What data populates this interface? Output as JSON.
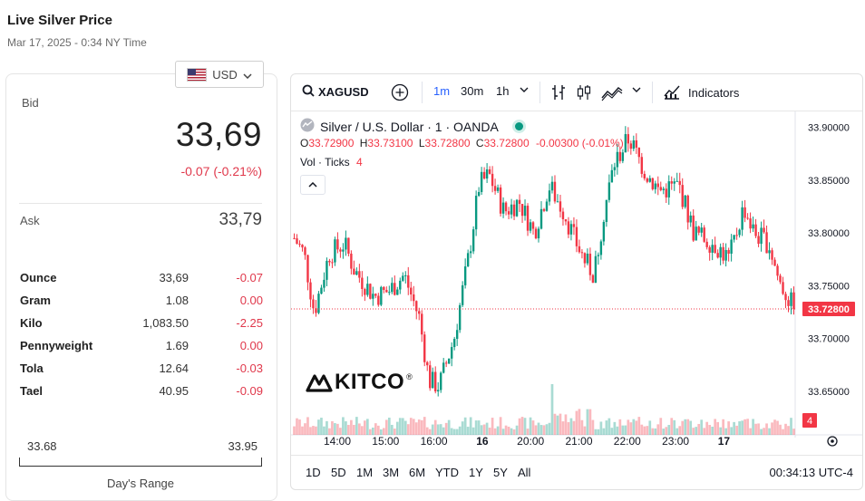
{
  "header": {
    "title": "Live Silver Price",
    "subtitle": "Mar 17, 2025 - 0:34 NY Time"
  },
  "currency": {
    "label": "USD",
    "icon": "us-flag-icon"
  },
  "bid": {
    "label": "Bid",
    "price": "33,69",
    "change": "-0.07 (-0.21%)"
  },
  "ask": {
    "label": "Ask",
    "price": "33,79"
  },
  "units": [
    {
      "name": "Ounce",
      "value": "33,69",
      "change": "-0.07"
    },
    {
      "name": "Gram",
      "value": "1.08",
      "change": "0.00"
    },
    {
      "name": "Kilo",
      "value": "1,083.50",
      "change": "-2.25"
    },
    {
      "name": "Pennyweight",
      "value": "1.69",
      "change": "0.00"
    },
    {
      "name": "Tola",
      "value": "12.64",
      "change": "-0.03"
    },
    {
      "name": "Tael",
      "value": "40.95",
      "change": "-0.09"
    }
  ],
  "range": {
    "low": "33.68",
    "high": "33.95",
    "label": "Day's Range"
  },
  "toolbar": {
    "symbol": "XAGUSD",
    "intervals": [
      "1m",
      "30m",
      "1h"
    ],
    "indicators_label": "Indicators"
  },
  "legend": {
    "name": "Silver / U.S. Dollar · 1 · OANDA",
    "o_label": "O",
    "o": "33.72900",
    "h_label": "H",
    "h": "33.73100",
    "l_label": "L",
    "l": "33.72800",
    "c_label": "C",
    "c": "33.72800",
    "chg": "-0.00300 (-0.01%)",
    "vol_label": "Vol · Ticks",
    "vol": "4"
  },
  "watermark": "KITCO",
  "bottom": {
    "ranges": [
      "1D",
      "5D",
      "1M",
      "3M",
      "6M",
      "YTD",
      "1Y",
      "5Y",
      "All"
    ],
    "time": "00:34:13 UTC-4"
  },
  "colors": {
    "up": "#089981",
    "down": "#f23645",
    "accent": "#2962ff",
    "negative": "#e0384b"
  },
  "chart_data": {
    "type": "candlestick",
    "symbol": "XAGUSD",
    "x_ticks": [
      "14:00",
      "15:00",
      "16:00",
      "16",
      "20:00",
      "21:00",
      "22:00",
      "23:00",
      "17"
    ],
    "y_ticks": [
      "33.90000",
      "33.85000",
      "33.80000",
      "33.75000",
      "33.70000",
      "33.65000"
    ],
    "ylim": [
      33.625,
      33.915
    ],
    "last_price": "33.72800",
    "last_volume": "4",
    "close_path": [
      {
        "t": 0.0,
        "v": 33.795
      },
      {
        "t": 0.02,
        "v": 33.78
      },
      {
        "t": 0.04,
        "v": 33.725
      },
      {
        "t": 0.07,
        "v": 33.78
      },
      {
        "t": 0.1,
        "v": 33.79
      },
      {
        "t": 0.12,
        "v": 33.765
      },
      {
        "t": 0.16,
        "v": 33.74
      },
      {
        "t": 0.19,
        "v": 33.745
      },
      {
        "t": 0.22,
        "v": 33.76
      },
      {
        "t": 0.25,
        "v": 33.72
      },
      {
        "t": 0.27,
        "v": 33.66
      },
      {
        "t": 0.29,
        "v": 33.655
      },
      {
        "t": 0.32,
        "v": 33.7
      },
      {
        "t": 0.35,
        "v": 33.78
      },
      {
        "t": 0.37,
        "v": 33.845
      },
      {
        "t": 0.39,
        "v": 33.855
      },
      {
        "t": 0.42,
        "v": 33.82
      },
      {
        "t": 0.45,
        "v": 33.83
      },
      {
        "t": 0.48,
        "v": 33.8
      },
      {
        "t": 0.51,
        "v": 33.845
      },
      {
        "t": 0.54,
        "v": 33.82
      },
      {
        "t": 0.56,
        "v": 33.795
      },
      {
        "t": 0.58,
        "v": 33.775
      },
      {
        "t": 0.6,
        "v": 33.76
      },
      {
        "t": 0.62,
        "v": 33.82
      },
      {
        "t": 0.64,
        "v": 33.865
      },
      {
        "t": 0.67,
        "v": 33.89
      },
      {
        "t": 0.7,
        "v": 33.86
      },
      {
        "t": 0.73,
        "v": 33.84
      },
      {
        "t": 0.77,
        "v": 33.845
      },
      {
        "t": 0.8,
        "v": 33.8
      },
      {
        "t": 0.84,
        "v": 33.79
      },
      {
        "t": 0.87,
        "v": 33.775
      },
      {
        "t": 0.9,
        "v": 33.825
      },
      {
        "t": 0.92,
        "v": 33.8
      },
      {
        "t": 0.95,
        "v": 33.79
      },
      {
        "t": 0.97,
        "v": 33.755
      },
      {
        "t": 1.0,
        "v": 33.728
      }
    ]
  }
}
